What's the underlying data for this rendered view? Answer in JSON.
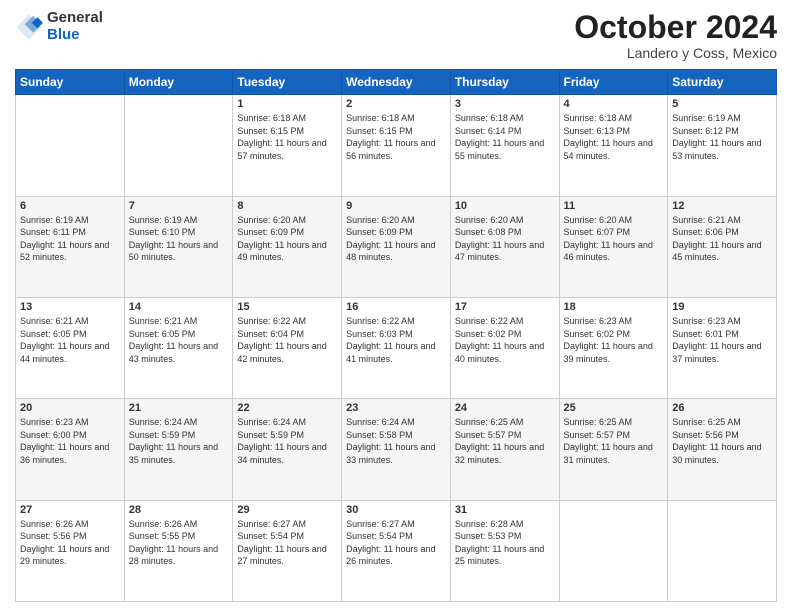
{
  "header": {
    "logo": {
      "general": "General",
      "blue": "Blue"
    },
    "month": "October 2024",
    "location": "Landero y Coss, Mexico"
  },
  "days_of_week": [
    "Sunday",
    "Monday",
    "Tuesday",
    "Wednesday",
    "Thursday",
    "Friday",
    "Saturday"
  ],
  "weeks": [
    [
      {
        "day": "",
        "info": ""
      },
      {
        "day": "",
        "info": ""
      },
      {
        "day": "1",
        "sunrise": "6:18 AM",
        "sunset": "6:15 PM",
        "daylight": "11 hours and 57 minutes."
      },
      {
        "day": "2",
        "sunrise": "6:18 AM",
        "sunset": "6:15 PM",
        "daylight": "11 hours and 56 minutes."
      },
      {
        "day": "3",
        "sunrise": "6:18 AM",
        "sunset": "6:14 PM",
        "daylight": "11 hours and 55 minutes."
      },
      {
        "day": "4",
        "sunrise": "6:18 AM",
        "sunset": "6:13 PM",
        "daylight": "11 hours and 54 minutes."
      },
      {
        "day": "5",
        "sunrise": "6:19 AM",
        "sunset": "6:12 PM",
        "daylight": "11 hours and 53 minutes."
      }
    ],
    [
      {
        "day": "6",
        "sunrise": "6:19 AM",
        "sunset": "6:11 PM",
        "daylight": "11 hours and 52 minutes."
      },
      {
        "day": "7",
        "sunrise": "6:19 AM",
        "sunset": "6:10 PM",
        "daylight": "11 hours and 50 minutes."
      },
      {
        "day": "8",
        "sunrise": "6:20 AM",
        "sunset": "6:09 PM",
        "daylight": "11 hours and 49 minutes."
      },
      {
        "day": "9",
        "sunrise": "6:20 AM",
        "sunset": "6:09 PM",
        "daylight": "11 hours and 48 minutes."
      },
      {
        "day": "10",
        "sunrise": "6:20 AM",
        "sunset": "6:08 PM",
        "daylight": "11 hours and 47 minutes."
      },
      {
        "day": "11",
        "sunrise": "6:20 AM",
        "sunset": "6:07 PM",
        "daylight": "11 hours and 46 minutes."
      },
      {
        "day": "12",
        "sunrise": "6:21 AM",
        "sunset": "6:06 PM",
        "daylight": "11 hours and 45 minutes."
      }
    ],
    [
      {
        "day": "13",
        "sunrise": "6:21 AM",
        "sunset": "6:05 PM",
        "daylight": "11 hours and 44 minutes."
      },
      {
        "day": "14",
        "sunrise": "6:21 AM",
        "sunset": "6:05 PM",
        "daylight": "11 hours and 43 minutes."
      },
      {
        "day": "15",
        "sunrise": "6:22 AM",
        "sunset": "6:04 PM",
        "daylight": "11 hours and 42 minutes."
      },
      {
        "day": "16",
        "sunrise": "6:22 AM",
        "sunset": "6:03 PM",
        "daylight": "11 hours and 41 minutes."
      },
      {
        "day": "17",
        "sunrise": "6:22 AM",
        "sunset": "6:02 PM",
        "daylight": "11 hours and 40 minutes."
      },
      {
        "day": "18",
        "sunrise": "6:23 AM",
        "sunset": "6:02 PM",
        "daylight": "11 hours and 39 minutes."
      },
      {
        "day": "19",
        "sunrise": "6:23 AM",
        "sunset": "6:01 PM",
        "daylight": "11 hours and 37 minutes."
      }
    ],
    [
      {
        "day": "20",
        "sunrise": "6:23 AM",
        "sunset": "6:00 PM",
        "daylight": "11 hours and 36 minutes."
      },
      {
        "day": "21",
        "sunrise": "6:24 AM",
        "sunset": "5:59 PM",
        "daylight": "11 hours and 35 minutes."
      },
      {
        "day": "22",
        "sunrise": "6:24 AM",
        "sunset": "5:59 PM",
        "daylight": "11 hours and 34 minutes."
      },
      {
        "day": "23",
        "sunrise": "6:24 AM",
        "sunset": "5:58 PM",
        "daylight": "11 hours and 33 minutes."
      },
      {
        "day": "24",
        "sunrise": "6:25 AM",
        "sunset": "5:57 PM",
        "daylight": "11 hours and 32 minutes."
      },
      {
        "day": "25",
        "sunrise": "6:25 AM",
        "sunset": "5:57 PM",
        "daylight": "11 hours and 31 minutes."
      },
      {
        "day": "26",
        "sunrise": "6:25 AM",
        "sunset": "5:56 PM",
        "daylight": "11 hours and 30 minutes."
      }
    ],
    [
      {
        "day": "27",
        "sunrise": "6:26 AM",
        "sunset": "5:56 PM",
        "daylight": "11 hours and 29 minutes."
      },
      {
        "day": "28",
        "sunrise": "6:26 AM",
        "sunset": "5:55 PM",
        "daylight": "11 hours and 28 minutes."
      },
      {
        "day": "29",
        "sunrise": "6:27 AM",
        "sunset": "5:54 PM",
        "daylight": "11 hours and 27 minutes."
      },
      {
        "day": "30",
        "sunrise": "6:27 AM",
        "sunset": "5:54 PM",
        "daylight": "11 hours and 26 minutes."
      },
      {
        "day": "31",
        "sunrise": "6:28 AM",
        "sunset": "5:53 PM",
        "daylight": "11 hours and 25 minutes."
      },
      {
        "day": "",
        "info": ""
      },
      {
        "day": "",
        "info": ""
      }
    ]
  ]
}
